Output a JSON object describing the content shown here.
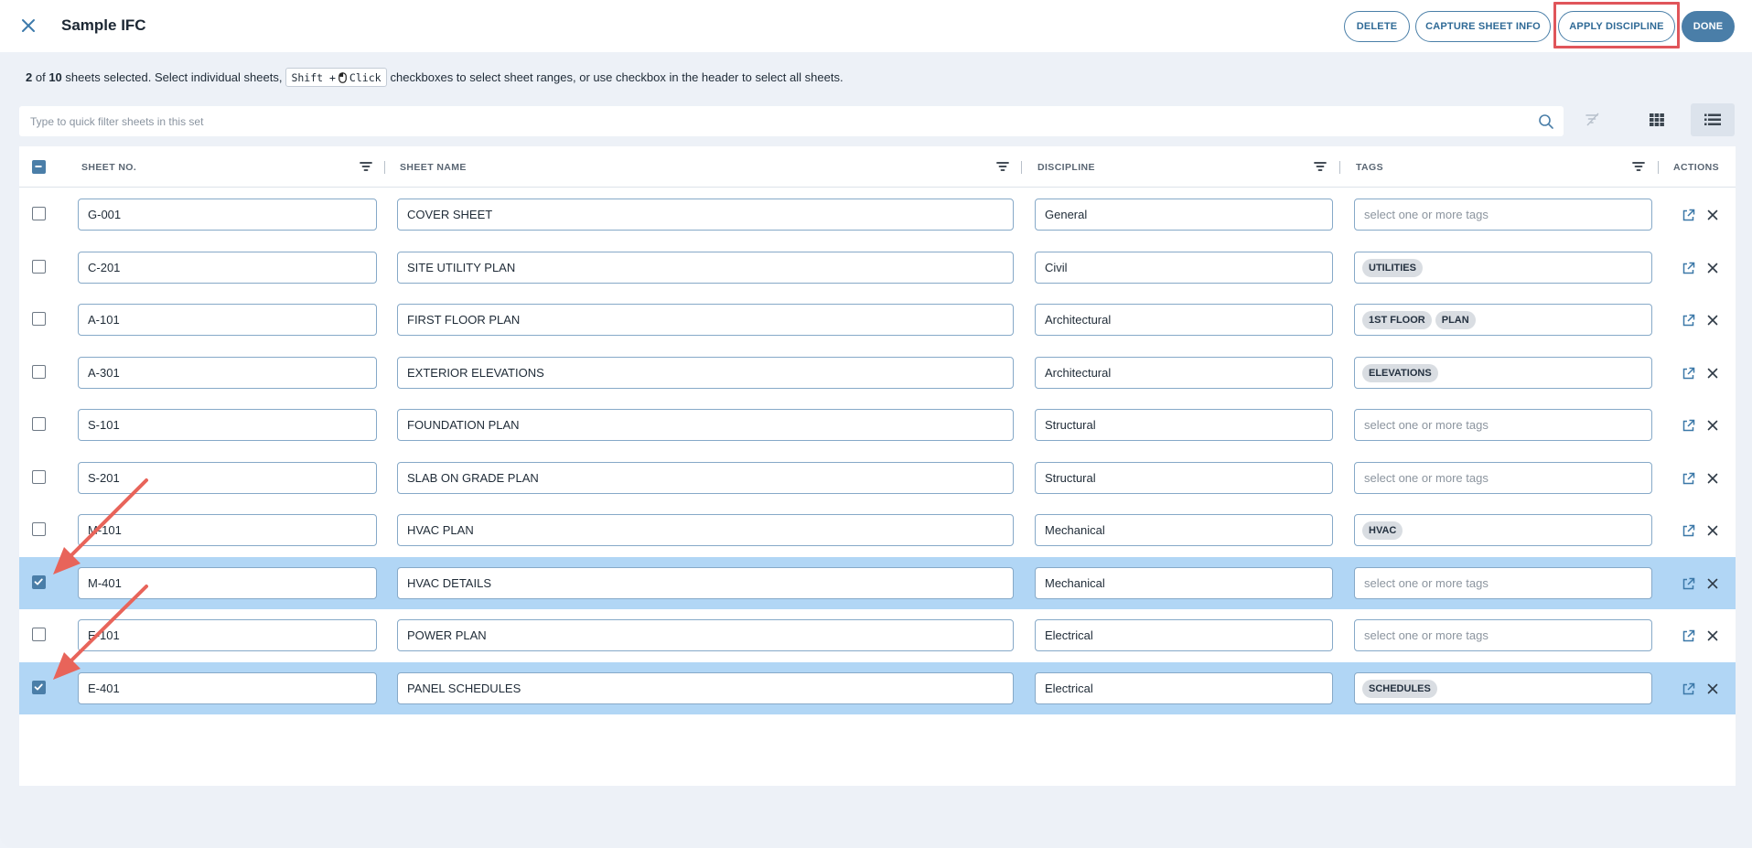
{
  "header": {
    "title": "Sample IFC",
    "buttons": {
      "delete": "DELETE",
      "capture": "CAPTURE SHEET INFO",
      "apply_discipline": "APPLY DISCIPLINE",
      "done": "DONE"
    }
  },
  "info": {
    "selected": "2",
    "of": "of",
    "total": "10",
    "text1": "sheets selected. Select individual sheets,",
    "kbd_shift": "Shift +",
    "kbd_click": "Click",
    "text2": "checkboxes to select sheet ranges, or use checkbox in the header to select all sheets."
  },
  "filter": {
    "placeholder": "Type to quick filter sheets in this set"
  },
  "columns": {
    "sheet_no": "SHEET NO.",
    "sheet_name": "SHEET NAME",
    "discipline": "DISCIPLINE",
    "tags": "TAGS",
    "actions": "ACTIONS"
  },
  "tags_placeholder": "select one or more tags",
  "rows": [
    {
      "no": "G-001",
      "name": "COVER SHEET",
      "discipline": "General",
      "tags": [],
      "selected": false
    },
    {
      "no": "C-201",
      "name": "SITE UTILITY PLAN",
      "discipline": "Civil",
      "tags": [
        "UTILITIES"
      ],
      "selected": false
    },
    {
      "no": "A-101",
      "name": "FIRST FLOOR PLAN",
      "discipline": "Architectural",
      "tags": [
        "1ST FLOOR",
        "PLAN"
      ],
      "selected": false
    },
    {
      "no": "A-301",
      "name": "EXTERIOR ELEVATIONS",
      "discipline": "Architectural",
      "tags": [
        "ELEVATIONS"
      ],
      "selected": false
    },
    {
      "no": "S-101",
      "name": "FOUNDATION PLAN",
      "discipline": "Structural",
      "tags": [],
      "selected": false
    },
    {
      "no": "S-201",
      "name": "SLAB ON GRADE PLAN",
      "discipline": "Structural",
      "tags": [],
      "selected": false
    },
    {
      "no": "M-101",
      "name": "HVAC PLAN",
      "discipline": "Mechanical",
      "tags": [
        "HVAC"
      ],
      "selected": false
    },
    {
      "no": "M-401",
      "name": "HVAC DETAILS",
      "discipline": "Mechanical",
      "tags": [],
      "selected": true
    },
    {
      "no": "E-101",
      "name": "POWER PLAN",
      "discipline": "Electrical",
      "tags": [],
      "selected": false
    },
    {
      "no": "E-401",
      "name": "PANEL SCHEDULES",
      "discipline": "Electrical",
      "tags": [
        "SCHEDULES"
      ],
      "selected": true
    }
  ],
  "colors": {
    "accent": "#4a7ea8",
    "selected_row": "#b1d6f5",
    "annotation": "#e0555a"
  }
}
